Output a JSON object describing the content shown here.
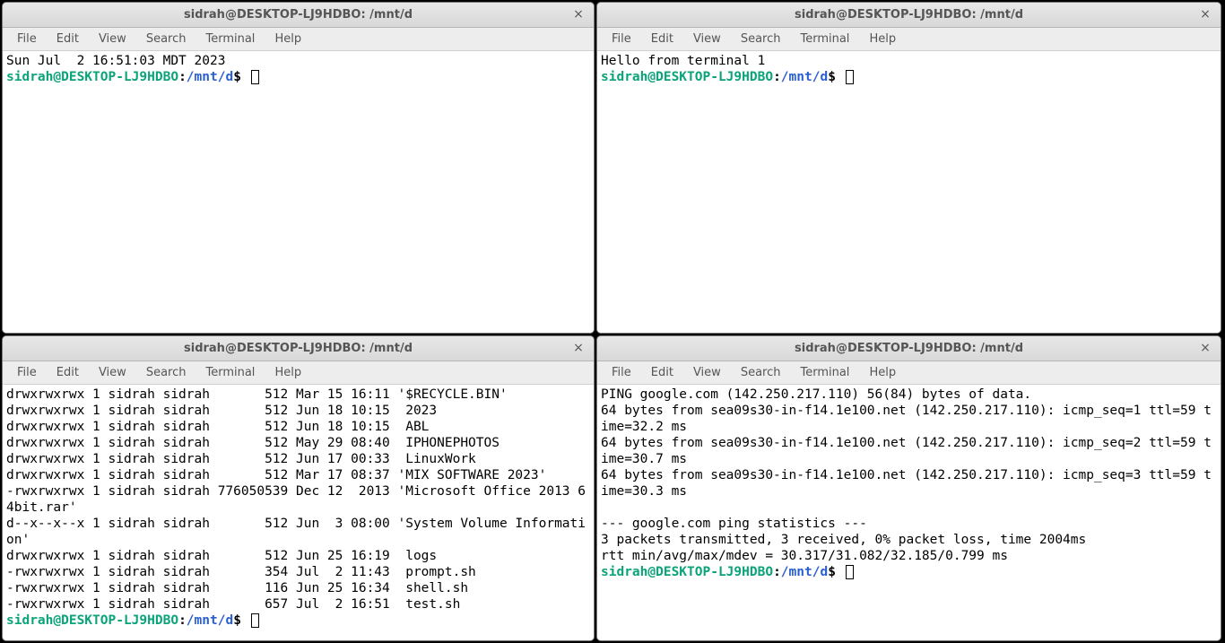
{
  "menu_labels": {
    "file": "File",
    "edit": "Edit",
    "view": "View",
    "search": "Search",
    "terminal": "Terminal",
    "help": "Help"
  },
  "close_glyph": "×",
  "prompt": {
    "userhost": "sidrah@DESKTOP-LJ9HDBO",
    "colon": ":",
    "path": "/mnt/d",
    "dollar": "$ "
  },
  "windows": {
    "tl": {
      "title": "sidrah@DESKTOP-LJ9HDBO: /mnt/d",
      "lines": [
        "Sun Jul  2 16:51:03 MDT 2023"
      ]
    },
    "tr": {
      "title": "sidrah@DESKTOP-LJ9HDBO: /mnt/d",
      "lines": [
        "Hello from terminal 1"
      ]
    },
    "bl": {
      "title": "sidrah@DESKTOP-LJ9HDBO: /mnt/d",
      "lines": [
        "drwxrwxrwx 1 sidrah sidrah       512 Mar 15 16:11 '$RECYCLE.BIN'",
        "drwxrwxrwx 1 sidrah sidrah       512 Jun 18 10:15  2023",
        "drwxrwxrwx 1 sidrah sidrah       512 Jun 18 10:15  ABL",
        "drwxrwxrwx 1 sidrah sidrah       512 May 29 08:40  IPHONEPHOTOS",
        "drwxrwxrwx 1 sidrah sidrah       512 Jun 17 00:33  LinuxWork",
        "drwxrwxrwx 1 sidrah sidrah       512 Mar 17 08:37 'MIX SOFTWARE 2023'",
        "-rwxrwxrwx 1 sidrah sidrah 776050539 Dec 12  2013 'Microsoft Office 2013 64bit.rar'",
        "d--x--x--x 1 sidrah sidrah       512 Jun  3 08:00 'System Volume Information'",
        "drwxrwxrwx 1 sidrah sidrah       512 Jun 25 16:19  logs",
        "-rwxrwxrwx 1 sidrah sidrah       354 Jul  2 11:43  prompt.sh",
        "-rwxrwxrwx 1 sidrah sidrah       116 Jun 25 16:34  shell.sh",
        "-rwxrwxrwx 1 sidrah sidrah       657 Jul  2 16:51  test.sh"
      ]
    },
    "br": {
      "title": "sidrah@DESKTOP-LJ9HDBO: /mnt/d",
      "lines": [
        "PING google.com (142.250.217.110) 56(84) bytes of data.",
        "64 bytes from sea09s30-in-f14.1e100.net (142.250.217.110): icmp_seq=1 ttl=59 time=32.2 ms",
        "64 bytes from sea09s30-in-f14.1e100.net (142.250.217.110): icmp_seq=2 ttl=59 time=30.7 ms",
        "64 bytes from sea09s30-in-f14.1e100.net (142.250.217.110): icmp_seq=3 ttl=59 time=30.3 ms",
        "",
        "--- google.com ping statistics ---",
        "3 packets transmitted, 3 received, 0% packet loss, time 2004ms",
        "rtt min/avg/max/mdev = 30.317/31.082/32.185/0.799 ms"
      ]
    }
  }
}
